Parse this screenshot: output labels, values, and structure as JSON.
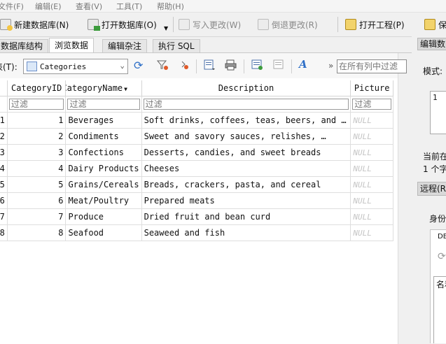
{
  "menu": [
    "文件(F)",
    "编辑(E)",
    "查看(V)",
    "工具(T)",
    "帮助(H)"
  ],
  "toolbar": {
    "new_db": "新建数据库(N)",
    "open_db": "打开数据库(O)",
    "write_changes": "写入更改(W)",
    "revert_changes": "倒退更改(R)",
    "open_project": "打开工程(P)",
    "save_partial": "保"
  },
  "tabs": [
    "数据库结构",
    "浏览数据",
    "编辑杂注",
    "执行 SQL"
  ],
  "active_tab": 1,
  "browse": {
    "table_label": "表(T):",
    "table_selected": "Categories",
    "filter_all_placeholder": "在所有列中过滤",
    "more": "»"
  },
  "grid": {
    "columns": [
      "CategoryID",
      "CategoryName",
      "Description",
      "Picture"
    ],
    "filter_placeholder": "过滤",
    "null_text": "NULL",
    "rows": [
      {
        "n": "1",
        "id": "1",
        "name": "Beverages",
        "desc": "Soft drinks, coffees, teas, beers, and …"
      },
      {
        "n": "2",
        "id": "2",
        "name": "Condiments",
        "desc": "Sweet and savory sauces, relishes, …"
      },
      {
        "n": "3",
        "id": "3",
        "name": "Confections",
        "desc": "Desserts, candies, and sweet breads"
      },
      {
        "n": "4",
        "id": "4",
        "name": "Dairy Products",
        "desc": "Cheeses"
      },
      {
        "n": "5",
        "id": "5",
        "name": "Grains/Cereals",
        "desc": "Breads, crackers, pasta, and cereal"
      },
      {
        "n": "6",
        "id": "6",
        "name": "Meat/Poultry",
        "desc": "Prepared meats"
      },
      {
        "n": "7",
        "id": "7",
        "name": "Produce",
        "desc": "Dried fruit and bean curd"
      },
      {
        "n": "8",
        "id": "8",
        "name": "Seafood",
        "desc": "Seaweed and fish"
      }
    ]
  },
  "right_panel": {
    "title": "编辑数",
    "mode": "模式:",
    "value": "1",
    "current_line1": "当前在",
    "current_line2": "1 个字",
    "remote": "远程(R",
    "identity": "身份",
    "db": "DB",
    "name": "名和"
  },
  "colors": {
    "accent": "#2e6fc7",
    "null": "#c4c4c4"
  }
}
